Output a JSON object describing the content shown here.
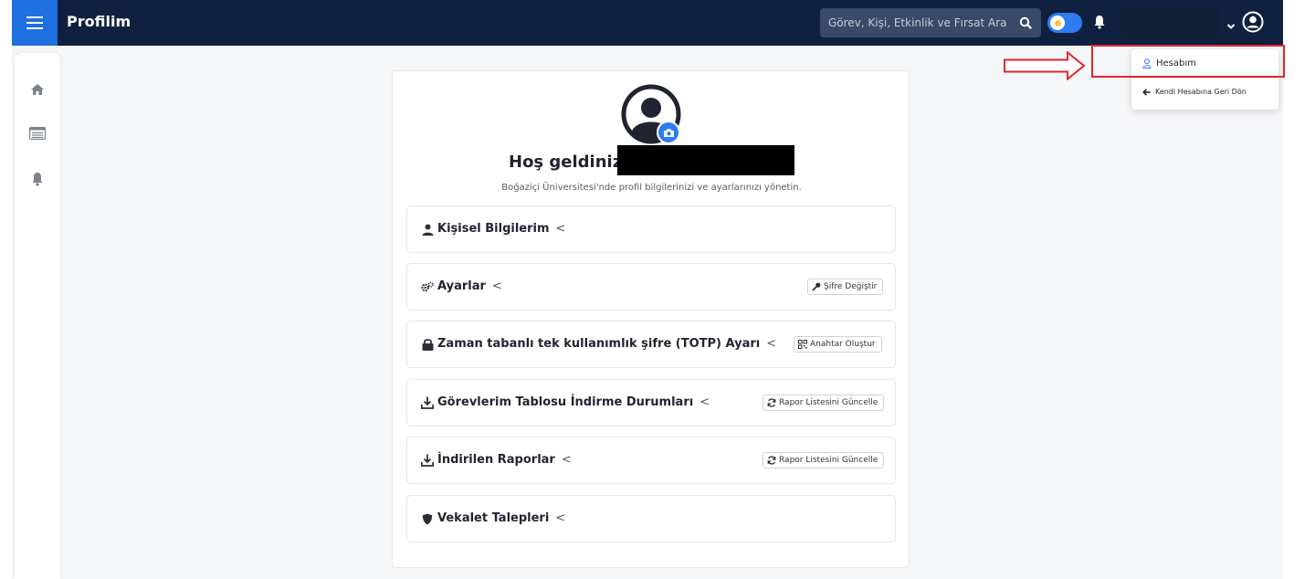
{
  "header": {
    "title": "Profilim",
    "search_placeholder": "Görev, Kişi, Etkinlik ve Fırsat Ara"
  },
  "sidebar": {
    "items": [
      {
        "icon": "home-icon"
      },
      {
        "icon": "list-icon"
      },
      {
        "icon": "bell-icon"
      }
    ]
  },
  "profile": {
    "welcome": "Hoş geldiniz,",
    "subtitle": "Boğaziçi Üniversitesi'nde profil bilgilerinizi ve ayarlarınızı yönetin."
  },
  "sections": [
    {
      "title": "Kişisel Bilgilerim",
      "icon": "user-icon",
      "button": ""
    },
    {
      "title": "Ayarlar",
      "icon": "gears-icon",
      "button": "Şifre Değiştir",
      "button_icon": "key-icon"
    },
    {
      "title": "Zaman tabanlı tek kullanımlık şifre (TOTP) Ayarı",
      "icon": "lock-icon",
      "button": "Anahtar Oluştur",
      "button_icon": "qr-icon"
    },
    {
      "title": "Görevlerim Tablosu İndirme Durumları",
      "icon": "download-icon",
      "button": "Rapor Listesini Güncelle",
      "button_icon": "refresh-icon"
    },
    {
      "title": "İndirilen Raporlar",
      "icon": "download-icon",
      "button": "Rapor Listesini Güncelle",
      "button_icon": "refresh-icon"
    },
    {
      "title": "Vekalet Talepleri",
      "icon": "shield-icon",
      "button": ""
    }
  ],
  "user_menu": {
    "account": "Hesabım",
    "back": "Kendi Hesabına Geri Dön"
  },
  "colors": {
    "topbar": "#10213f",
    "accent": "#1e6fe0",
    "annotation": "#e0262b"
  }
}
